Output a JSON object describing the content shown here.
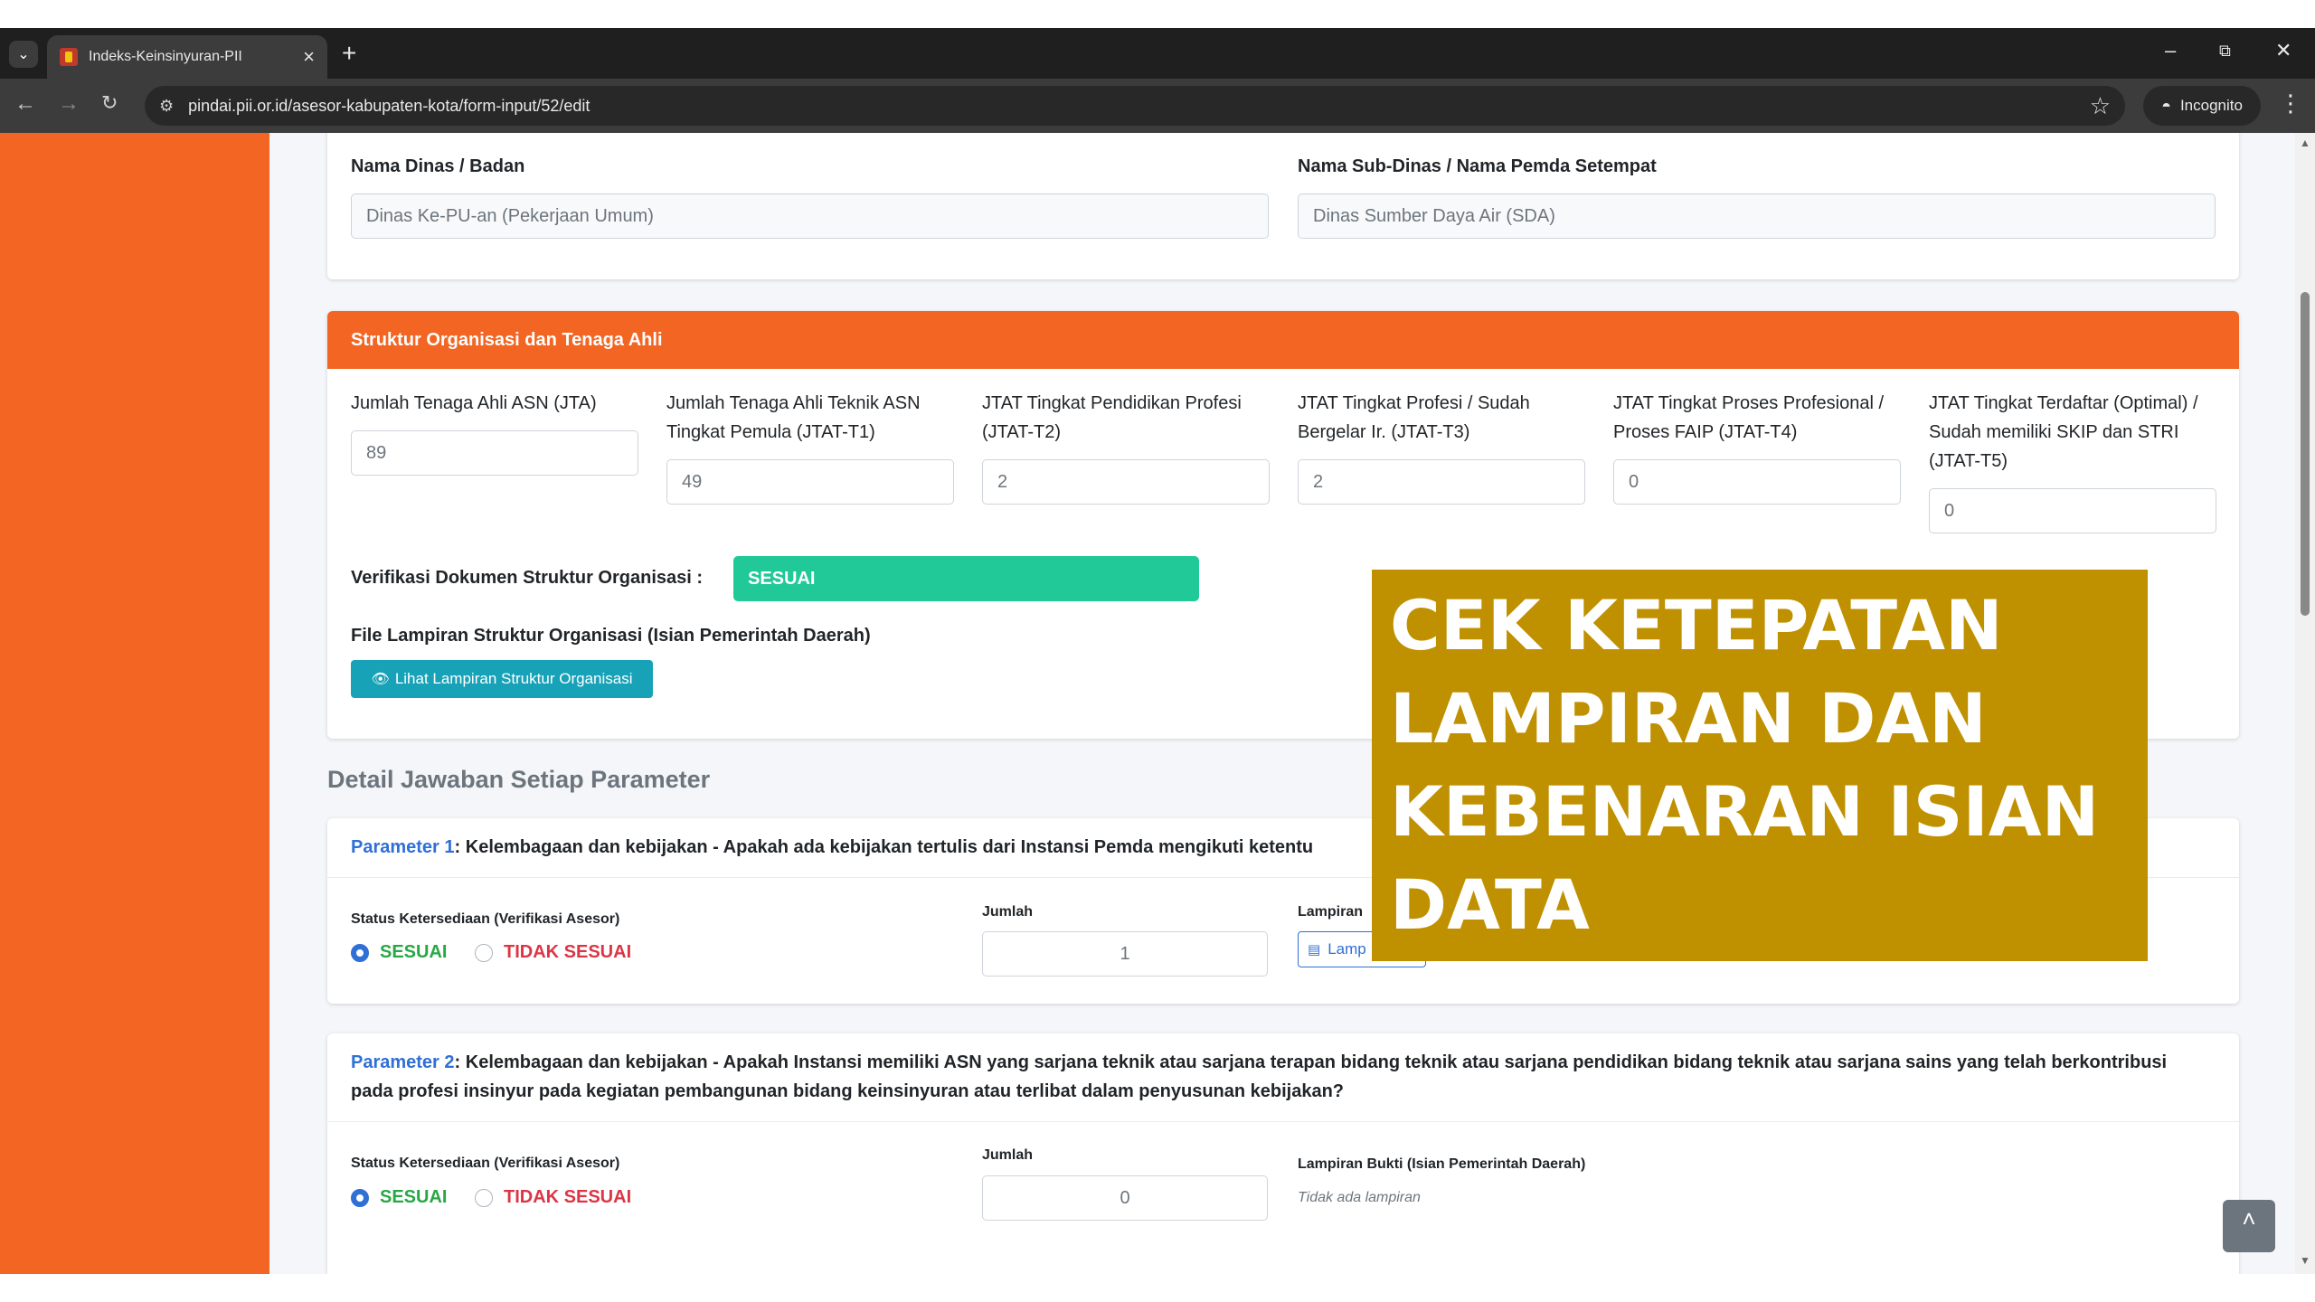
{
  "browser": {
    "tab_title": "Indeks-Keinsinyuran-PII",
    "url": "pindai.pii.or.id/asesor-kabupaten-kota/form-input/52/edit",
    "incognito_label": "Incognito"
  },
  "dinas_card": {
    "nama_dinas_label": "Nama Dinas / Badan",
    "nama_dinas_value": "Dinas Ke-PU-an (Pekerjaan Umum)",
    "sub_dinas_label": "Nama Sub-Dinas / Nama Pemda Setempat",
    "sub_dinas_value": "Dinas Sumber Daya Air (SDA)"
  },
  "struktur_card": {
    "header": "Struktur Organisasi dan Tenaga Ahli",
    "fields": [
      {
        "label": "Jumlah Tenaga Ahli ASN (JTA)",
        "value": "89"
      },
      {
        "label": "Jumlah Tenaga Ahli Teknik ASN Tingkat Pemula (JTAT-T1)",
        "value": "49"
      },
      {
        "label": "JTAT Tingkat Pendidikan Profesi (JTAT-T2)",
        "value": "2"
      },
      {
        "label": "JTAT Tingkat Profesi / Sudah Bergelar Ir. (JTAT-T3)",
        "value": "2"
      },
      {
        "label": "JTAT Tingkat Proses Profesional / Proses FAIP (JTAT-T4)",
        "value": "0"
      },
      {
        "label": "JTAT Tingkat Terdaftar (Optimal) / Sudah memiliki SKIP dan STRI (JTAT-T5)",
        "value": "0"
      }
    ],
    "verifikasi_label": "Verifikasi Dokumen Struktur Organisasi :",
    "verifikasi_value": "SESUAI",
    "file_label": "File Lampiran Struktur Organisasi (Isian Pemerintah Daerah)",
    "file_button": "Lihat Lampiran Struktur Organisasi"
  },
  "section_title": "Detail Jawaban Setiap Parameter",
  "params": [
    {
      "num": "Parameter 1",
      "question": ": Kelembagaan dan kebijakan - Apakah ada kebijakan tertulis dari Instansi Pemda mengikuti ketentu",
      "status_label": "Status Ketersediaan (Verifikasi Asesor)",
      "opt_yes": "SESUAI",
      "opt_no": "TIDAK SESUAI",
      "jumlah_label": "Jumlah",
      "jumlah_value": "1",
      "lampiran_label": "Lampiran",
      "lampiran_button": "Lamp"
    },
    {
      "num": "Parameter 2",
      "question": ": Kelembagaan dan kebijakan - Apakah Instansi memiliki ASN yang sarjana teknik atau sarjana terapan bidang teknik atau sarjana pendidikan bidang teknik atau sarjana sains yang telah berkontribusi pada profesi insinyur pada kegiatan pembangunan bidang keinsinyuran atau terlibat dalam penyusunan kebijakan?",
      "status_label": "Status Ketersediaan (Verifikasi Asesor)",
      "opt_yes": "SESUAI",
      "opt_no": "TIDAK SESUAI",
      "jumlah_label": "Jumlah",
      "jumlah_value": "0",
      "lampiran_label": "Lampiran Bukti (Isian Pemerintah Daerah)",
      "lampiran_none": "Tidak ada lampiran"
    }
  ],
  "overlay_text": "CEK KETEPATAN LAMPIRAN DAN KEBENARAN ISIAN DATA",
  "colors": {
    "brand_orange": "#f26522",
    "success": "#20c997",
    "info": "#17a2b8",
    "overlay_gold": "#bf9000"
  }
}
